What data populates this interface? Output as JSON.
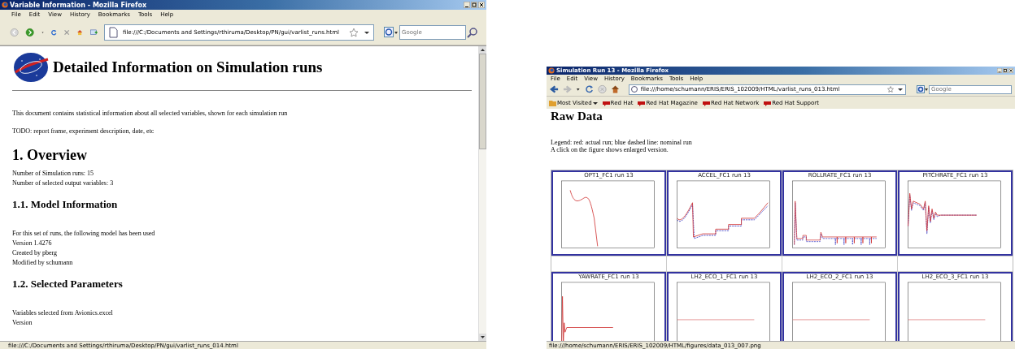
{
  "left_window": {
    "title": "Variable Information - Mozilla Firefox",
    "menu": [
      "File",
      "Edit",
      "View",
      "History",
      "Bookmarks",
      "Tools",
      "Help"
    ],
    "address": "file:///C:/Documents and Settings/rthiruma/Desktop/PN/gui/varlist_runs.html",
    "search": {
      "placeholder": "Google"
    },
    "heading": "Detailed Information on Simulation runs",
    "blocks": [
      {
        "kind": "para",
        "lines": [
          "This document contains statistical information about all selected variables, shown for each simulation run"
        ]
      },
      {
        "kind": "para",
        "lines": [
          "TODO: report frame, experiment description, date, etc"
        ]
      },
      {
        "kind": "h1",
        "text": "1. Overview"
      },
      {
        "kind": "para",
        "lines": [
          "Number of Simulation runs: 15",
          "Number of selected output variables: 3"
        ]
      },
      {
        "kind": "h2",
        "text": "1.1. Model Information"
      },
      {
        "kind": "para",
        "lines": [
          "For this set of runs, the following model has been used",
          "Version 1.4276",
          "Created by pberg",
          "Modified by schumann"
        ]
      },
      {
        "kind": "h2",
        "text": "1.2. Selected Parameters"
      },
      {
        "kind": "para",
        "lines": [
          "Variables selected from Avionics.excel",
          "Version"
        ]
      }
    ],
    "status": "file:///C:/Documents and Settings/rthiruma/Desktop/PN/gui/varlist_runs_014.html"
  },
  "right_window": {
    "title": "Simulation Run 13 - Mozilla Firefox",
    "menu": [
      "File",
      "Edit",
      "View",
      "History",
      "Bookmarks",
      "Tools",
      "Help"
    ],
    "address": "file:///home/schumann/ERIS/ERIS_102009/HTML/varlist_runs_013.html",
    "search": {
      "placeholder": "Google"
    },
    "bookmarks": [
      "Most Visited",
      "Red Hat",
      "Red Hat Magazine",
      "Red Hat Network",
      "Red Hat Support"
    ],
    "heading": "Raw Data",
    "legend": [
      "Legend: red: actual run; blue dashed line: nominal run",
      "A click on the figure shows enlarged version."
    ],
    "plots": [
      {
        "title": "OPT1_FC1 run 13",
        "kind": "drop"
      },
      {
        "title": "ACCEL_FC1 run 13",
        "kind": "ramp"
      },
      {
        "title": "ROLLRATE_FC1 run 13",
        "kind": "steps"
      },
      {
        "title": "PITCHRATE_FC1 run 13",
        "kind": "oscillation"
      },
      {
        "title": "YAWRATE_FC1 run 13",
        "kind": "spike"
      },
      {
        "title": "LH2_ECO_1_FC1 run 13",
        "kind": "flat"
      },
      {
        "title": "LH2_ECO_2_FC1 run 13",
        "kind": "flat"
      },
      {
        "title": "LH2_ECO_3_FC1 run 13",
        "kind": "flat"
      }
    ],
    "status": "file:///home/schumann/ERIS/ERIS_102009/HTML/figures/data_013_007.png"
  }
}
